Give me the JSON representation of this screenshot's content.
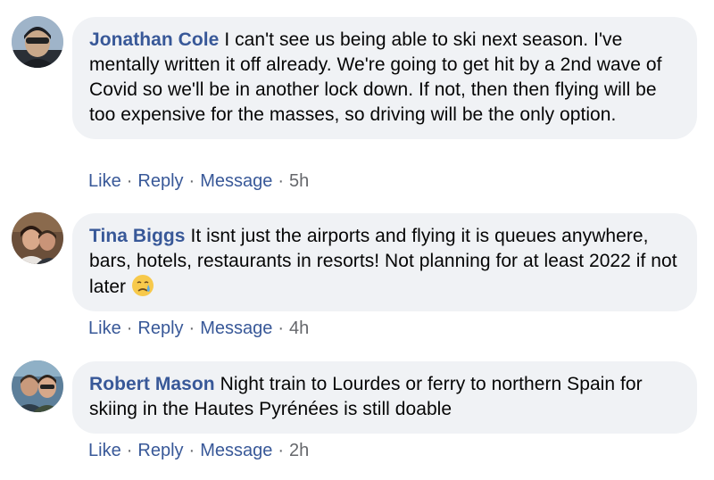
{
  "comments": [
    {
      "author": "Jonathan Cole",
      "text": "I can't see us being able to ski next season. I've mentally written it off already. We're going to get hit by a 2nd wave of Covid so we'll be in another lock down. If not, then then flying will be too expensive for the masses, so driving will be the only option.",
      "like": "Like",
      "reply": "Reply",
      "message": "Message",
      "time": "5h"
    },
    {
      "author": "Tina Biggs",
      "text": "It isnt just the airports and flying it is queues anywhere, bars, hotels, restaurants in resorts! Not planning for at least 2022 if not later",
      "emoji": "crying-face",
      "like": "Like",
      "reply": "Reply",
      "message": "Message",
      "time": "4h"
    },
    {
      "author": "Robert Mason",
      "text": "Night train to Lourdes or ferry to northern Spain for skiing in the Hautes Pyrénées is still doable",
      "like": "Like",
      "reply": "Reply",
      "message": "Message",
      "time": "2h"
    }
  ],
  "separator": "·",
  "colors": {
    "link": "#385898",
    "bubble": "#f0f2f5",
    "meta": "#65676b",
    "text": "#050505"
  }
}
